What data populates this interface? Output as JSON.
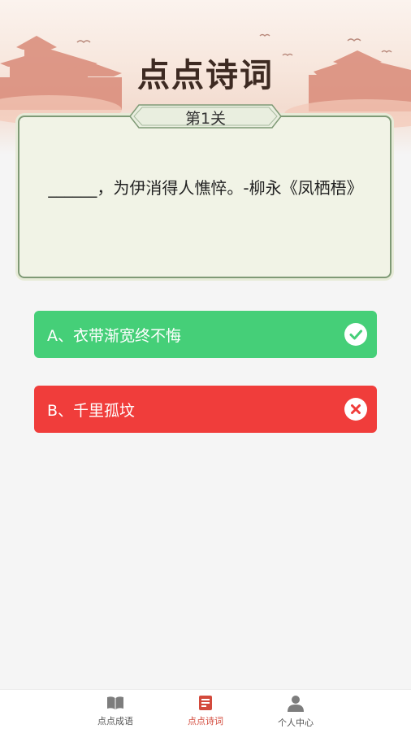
{
  "app": {
    "title": "点点诗词"
  },
  "level": {
    "label": "第1关"
  },
  "question": {
    "text": "______，为伊消得人憔悴。-柳永《凤栖梧》"
  },
  "options": [
    {
      "label": "A、衣带渐宽终不悔",
      "status": "correct",
      "color": "#45cf78",
      "icon": "check-icon"
    },
    {
      "label": "B、千里孤坟",
      "status": "wrong",
      "color": "#f03d3b",
      "icon": "close-icon"
    }
  ],
  "bottom_nav": {
    "items": [
      {
        "label": "点点成语",
        "icon": "book-icon",
        "active": false
      },
      {
        "label": "点点诗词",
        "icon": "notebook-icon",
        "active": true
      },
      {
        "label": "个人中心",
        "icon": "user-icon",
        "active": false
      }
    ],
    "active_color": "#d34a3c"
  }
}
